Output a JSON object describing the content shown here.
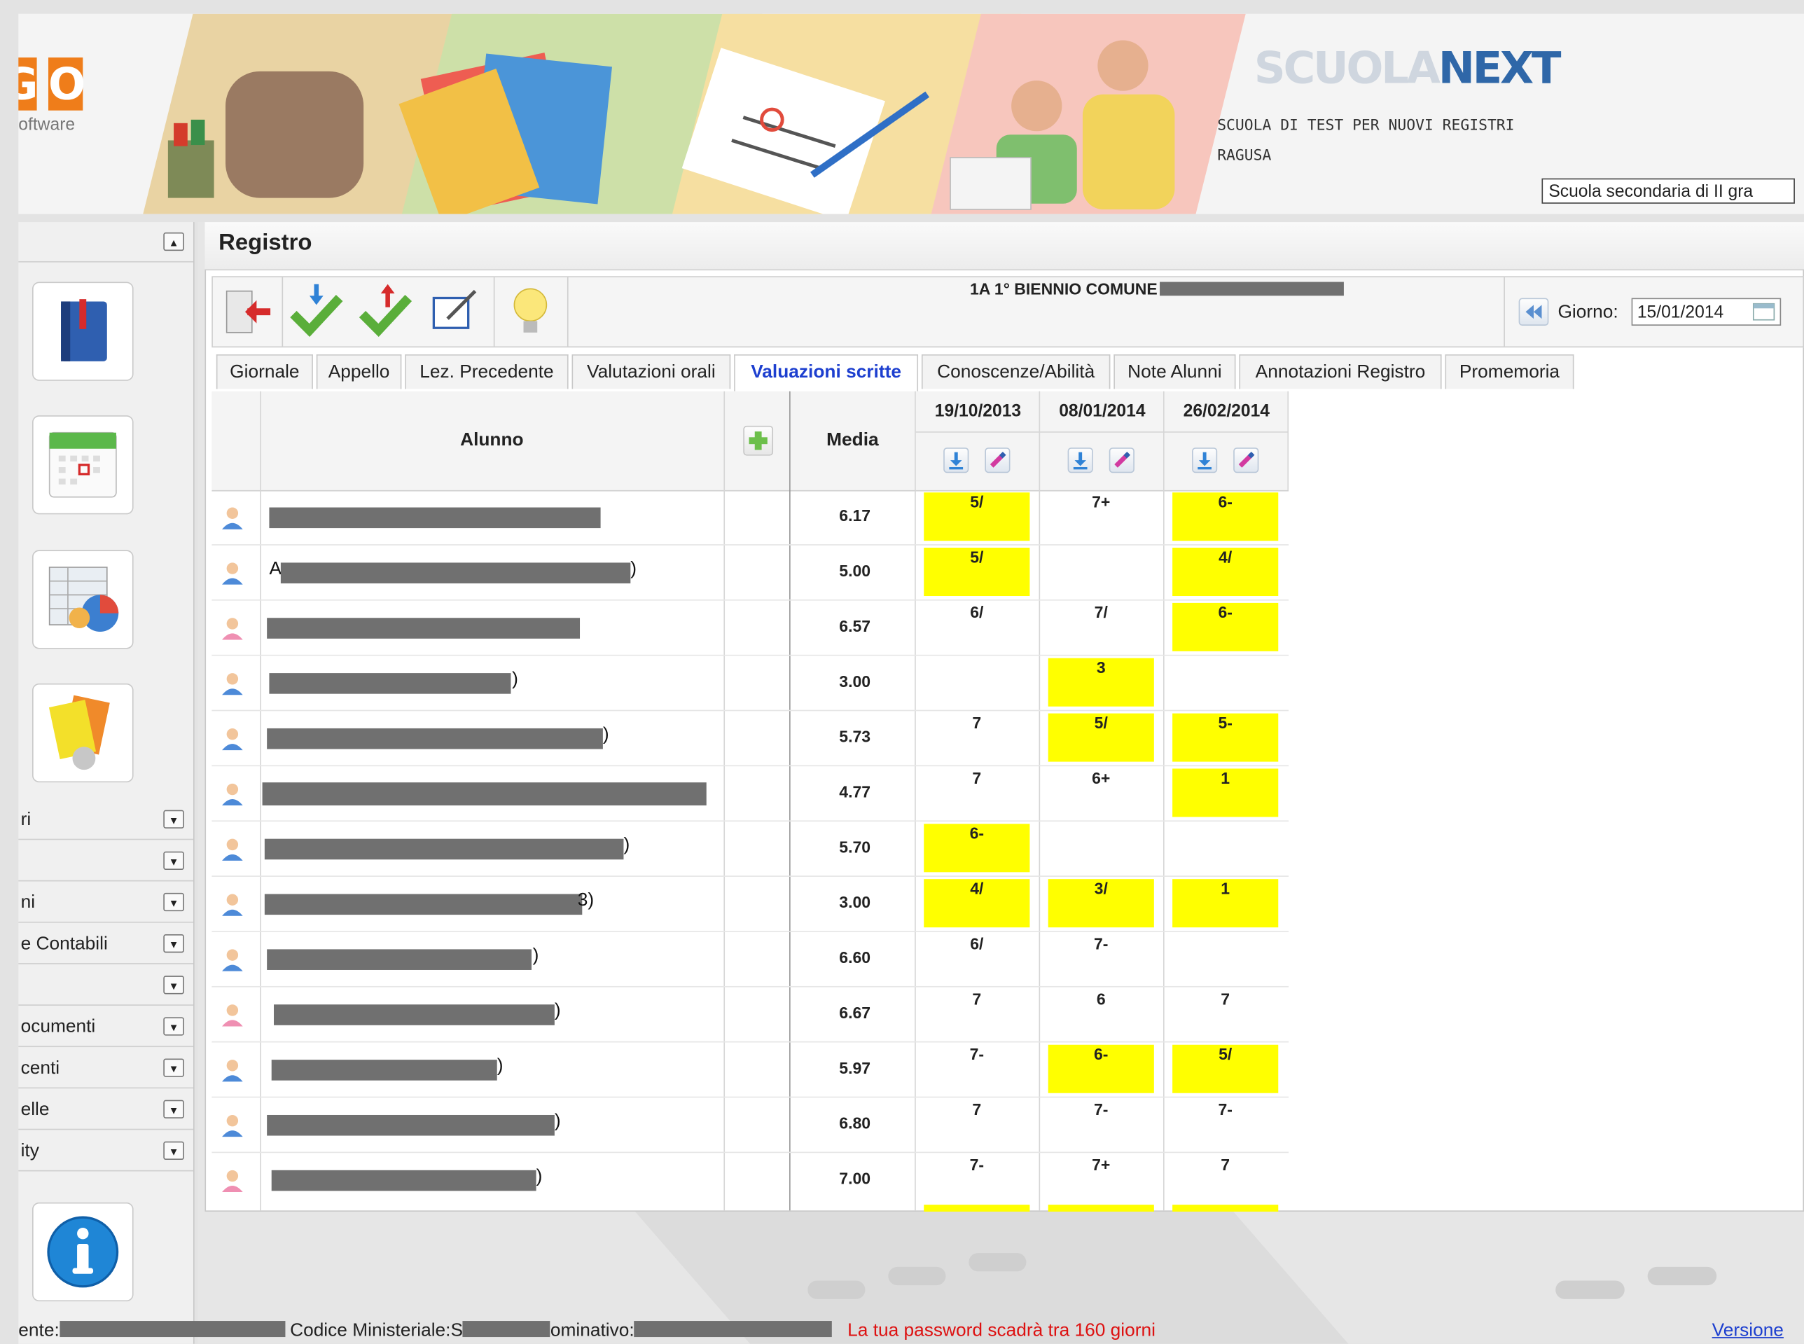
{
  "header": {
    "logo_letters": [
      "G",
      "O"
    ],
    "logo_sub": "oftware",
    "brand_part1": "SCUOLA",
    "brand_part2": "NEXT",
    "school_name": "SCUOLA DI TEST PER NUOVI REGISTRI",
    "school_city": "RAGUSA",
    "school_type_selected": "Scuola secondaria di II gra"
  },
  "sidebar": {
    "sections": [
      {
        "label": "ri"
      },
      {
        "label": ""
      },
      {
        "label": "ni"
      },
      {
        "label": "e Contabili"
      },
      {
        "label": ""
      },
      {
        "label": "ocumenti"
      },
      {
        "label": "centi"
      },
      {
        "label": "elle"
      },
      {
        "label": "ity"
      }
    ]
  },
  "page": {
    "title": "Registro",
    "class_label": "1A 1° BIENNIO COMUNE",
    "giorno_label": "Giorno:",
    "giorno_value": "15/01/2014"
  },
  "tabs": [
    {
      "label": "Giornale"
    },
    {
      "label": "Appello"
    },
    {
      "label": "Lez. Precedente"
    },
    {
      "label": "Valutazioni orali"
    },
    {
      "label": "Valuazioni scritte"
    },
    {
      "label": "Conoscenze/Abilità"
    },
    {
      "label": "Note Alunni"
    },
    {
      "label": "Annotazioni Registro"
    },
    {
      "label": "Promemoria"
    }
  ],
  "grid": {
    "col_alunno": "Alunno",
    "col_media": "Media",
    "dates": [
      "19/10/2013",
      "08/01/2014",
      "26/02/2014"
    ],
    "rows": [
      {
        "gender": "m",
        "prefix": "",
        "suffix": "",
        "media": "6.17",
        "grades": [
          {
            "v": "5/",
            "hl": true
          },
          {
            "v": "7+",
            "hl": false
          },
          {
            "v": "6-",
            "hl": true
          }
        ]
      },
      {
        "gender": "m",
        "prefix": "A",
        "suffix": ")",
        "media": "5.00",
        "grades": [
          {
            "v": "5/",
            "hl": true
          },
          {
            "v": "",
            "hl": false
          },
          {
            "v": "4/",
            "hl": true
          }
        ]
      },
      {
        "gender": "f",
        "prefix": "",
        "suffix": "",
        "media": "6.57",
        "grades": [
          {
            "v": "6/",
            "hl": false
          },
          {
            "v": "7/",
            "hl": false
          },
          {
            "v": "6-",
            "hl": true
          }
        ]
      },
      {
        "gender": "m",
        "prefix": "",
        "suffix": ")",
        "media": "3.00",
        "grades": [
          {
            "v": "",
            "hl": false
          },
          {
            "v": "3",
            "hl": true
          },
          {
            "v": "",
            "hl": false
          }
        ]
      },
      {
        "gender": "m",
        "prefix": "",
        "suffix": ")",
        "media": "5.73",
        "grades": [
          {
            "v": "7",
            "hl": false
          },
          {
            "v": "5/",
            "hl": true
          },
          {
            "v": "5-",
            "hl": true
          }
        ]
      },
      {
        "gender": "m",
        "prefix": "",
        "suffix": "",
        "media": "4.77",
        "grades": [
          {
            "v": "7",
            "hl": false
          },
          {
            "v": "6+",
            "hl": false
          },
          {
            "v": "1",
            "hl": true
          }
        ]
      },
      {
        "gender": "m",
        "prefix": "",
        "suffix": ")",
        "media": "5.70",
        "grades": [
          {
            "v": "6-",
            "hl": true
          },
          {
            "v": "",
            "hl": false
          },
          {
            "v": "",
            "hl": false
          }
        ]
      },
      {
        "gender": "m",
        "prefix": "",
        "suffix": "3)",
        "media": "3.00",
        "grades": [
          {
            "v": "4/",
            "hl": true
          },
          {
            "v": "3/",
            "hl": true
          },
          {
            "v": "1",
            "hl": true
          }
        ]
      },
      {
        "gender": "m",
        "prefix": "",
        "suffix": ")",
        "media": "6.60",
        "grades": [
          {
            "v": "6/",
            "hl": false
          },
          {
            "v": "7-",
            "hl": false
          },
          {
            "v": "",
            "hl": false
          }
        ]
      },
      {
        "gender": "f",
        "prefix": "",
        "suffix": ")",
        "media": "6.67",
        "grades": [
          {
            "v": "7",
            "hl": false
          },
          {
            "v": "6",
            "hl": false
          },
          {
            "v": "7",
            "hl": false
          }
        ]
      },
      {
        "gender": "m",
        "prefix": "",
        "suffix": ")",
        "media": "5.97",
        "grades": [
          {
            "v": "7-",
            "hl": false
          },
          {
            "v": "6-",
            "hl": true
          },
          {
            "v": "5/",
            "hl": true
          }
        ]
      },
      {
        "gender": "m",
        "prefix": "",
        "suffix": ")",
        "media": "6.80",
        "grades": [
          {
            "v": "7",
            "hl": false
          },
          {
            "v": "7-",
            "hl": false
          },
          {
            "v": "7-",
            "hl": false
          }
        ]
      },
      {
        "gender": "f",
        "prefix": "",
        "suffix": ")",
        "media": "7.00",
        "grades": [
          {
            "v": "7-",
            "hl": false
          },
          {
            "v": "7+",
            "hl": false
          },
          {
            "v": "7",
            "hl": false
          }
        ]
      }
    ]
  },
  "footer": {
    "utente_label": "ente:",
    "codice_label": "Codice Ministeriale:S",
    "nominativo_label": "ominativo:",
    "password_warning": "La tua password scadrà tra 160 giorni",
    "version_label": "Versione"
  },
  "colors": {
    "accent_blue": "#1d3fcf",
    "highlight_yellow": "#ffff00",
    "warning_red": "#dd1111",
    "brand_orange": "#ef7d1a"
  }
}
